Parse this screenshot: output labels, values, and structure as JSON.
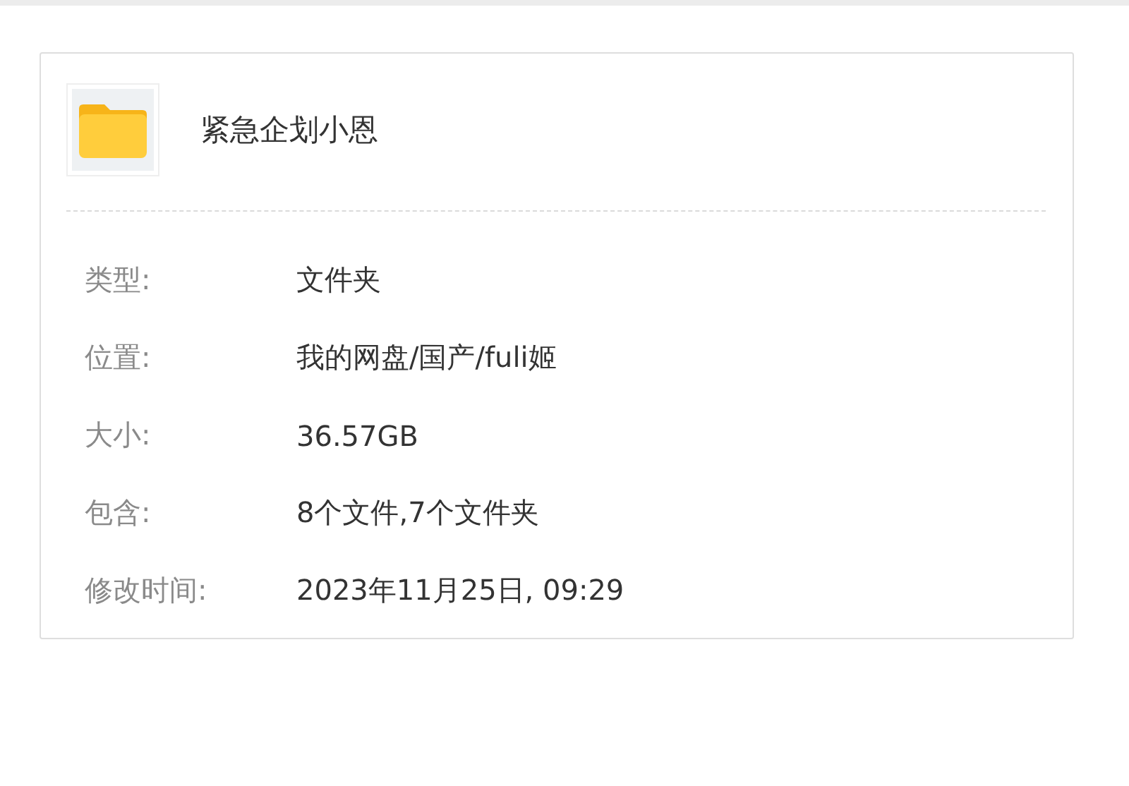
{
  "file": {
    "name": "紧急企划小恩"
  },
  "properties": [
    {
      "label": "类型:",
      "value": "文件夹"
    },
    {
      "label": "位置:",
      "value": "我的网盘/国产/fuli姬"
    },
    {
      "label": "大小:",
      "value": "36.57GB"
    },
    {
      "label": "包含:",
      "value": "8个文件,7个文件夹"
    },
    {
      "label": "修改时间:",
      "value": "2023年11月25日, 09:29"
    }
  ]
}
